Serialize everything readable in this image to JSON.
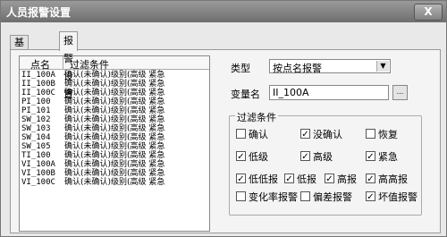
{
  "window": {
    "title": "人员报警设置",
    "close_label": "X"
  },
  "tabs": [
    "基本参数",
    "报警设置"
  ],
  "list": {
    "headers": [
      "点名",
      "过滤条件"
    ],
    "rows": [
      {
        "name": "II_100A",
        "filter": "确认(未确认)级别(高级 紧急"
      },
      {
        "name": "II_100B",
        "filter": "确认(未确认)级别(高级 紧急"
      },
      {
        "name": "II_100C",
        "filter": "确认(未确认)级别(高级 紧急"
      },
      {
        "name": "PI_100",
        "filter": "确认(未确认)级别(高级 紧急"
      },
      {
        "name": "PI_101",
        "filter": "确认(未确认)级别(高级 紧急"
      },
      {
        "name": "SW_102",
        "filter": "确认(未确认)级别(高级 紧急"
      },
      {
        "name": "SW_103",
        "filter": "确认(未确认)级别(高级 紧急"
      },
      {
        "name": "SW_104",
        "filter": "确认(未确认)级别(高级 紧急"
      },
      {
        "name": "SW_105",
        "filter": "确认(未确认)级别(高级 紧急"
      },
      {
        "name": "TI_100",
        "filter": "确认(未确认)级别(高级 紧急"
      },
      {
        "name": "VI_100A",
        "filter": "确认(未确认)级别(高级 紧急"
      },
      {
        "name": "VI_100B",
        "filter": "确认(未确认)级别(高级 紧急"
      },
      {
        "name": "VI_100C",
        "filter": "确认(未确认)级别(高级 紧急"
      }
    ]
  },
  "form": {
    "type_label": "类型",
    "type_value": "按点名报警",
    "var_label": "变量名",
    "var_value": "II_100A",
    "browse_label": "..."
  },
  "filter": {
    "title": "过滤条件",
    "checkboxes": [
      {
        "label": "确认",
        "checked": false
      },
      {
        "label": "没确认",
        "checked": true
      },
      {
        "label": "恢复",
        "checked": false
      },
      {
        "label": "低级",
        "checked": true
      },
      {
        "label": "高级",
        "checked": true
      },
      {
        "label": "紧急",
        "checked": true
      },
      {
        "label": "低低报",
        "checked": true
      },
      {
        "label": "低报",
        "checked": true
      },
      {
        "label": "高报",
        "checked": true
      },
      {
        "label": "高高报",
        "checked": true
      },
      {
        "label": "变化率报警",
        "checked": false
      },
      {
        "label": "偏差报警",
        "checked": false
      },
      {
        "label": "坏值报警",
        "checked": true
      }
    ]
  }
}
